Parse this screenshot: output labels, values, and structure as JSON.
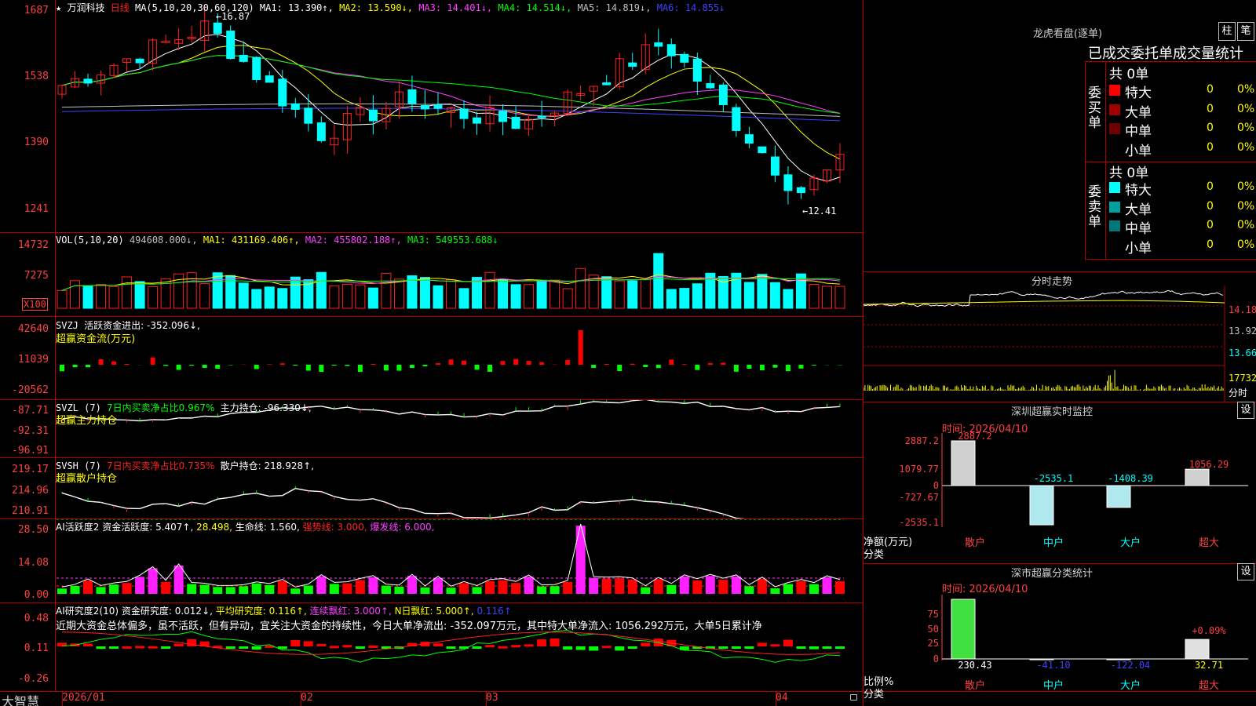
{
  "kline": {
    "star": "★",
    "stock_name": "万润科技",
    "period": "日线",
    "ma_header": "MA(5,10,20,30,60,120)",
    "ma_values": [
      {
        "label": "MA1: 13.390↑,",
        "color": "#ffffff"
      },
      {
        "label": "MA2: 13.590↓,",
        "color": "#ffff00"
      },
      {
        "label": "MA3: 14.401↓,",
        "color": "#ff40ff"
      },
      {
        "label": "MA4: 14.514↓,",
        "color": "#00ff00"
      },
      {
        "label": "MA5: 14.819↓,",
        "color": "#c0c0c0"
      },
      {
        "label": "MA6: 14.855↓",
        "color": "#4040ff"
      }
    ],
    "y_ticks": [
      "1687",
      "1538",
      "1390",
      "1241"
    ],
    "high_label": "16.87",
    "low_label": "12.41"
  },
  "vol": {
    "header": "VOL(5,10,20)",
    "values": [
      {
        "label": "494608.000↓,",
        "color": "#c0c0c0"
      },
      {
        "label": "MA1: 431169.406↑,",
        "color": "#ffff00"
      },
      {
        "label": "MA2: 455802.188↑,",
        "color": "#ff40ff"
      },
      {
        "label": "MA3: 549553.688↓",
        "color": "#00ff00"
      }
    ],
    "y_ticks": [
      "14732",
      "7275"
    ],
    "unit": "X100"
  },
  "svzj": {
    "header": "SVZJ",
    "label": "活跃资金进出: -352.096↓,",
    "subtitle": "超赢资金流(万元)",
    "y_ticks": [
      "42640",
      "11039",
      "-20562"
    ]
  },
  "svzl": {
    "header": "SVZL (7)",
    "label1": "7日内买卖净占比0.967%",
    "label2": "主力持仓: -96.330↓,",
    "subtitle": "超赢主力持仓",
    "y_ticks": [
      "-87.71",
      "-92.31",
      "-96.91"
    ]
  },
  "svsh": {
    "header": "SVSH (7)",
    "label1": "7日内买卖净占比0.735%",
    "label2": "散户持仓: 218.928↑,",
    "subtitle": "超赢散户持仓",
    "y_ticks": [
      "219.17",
      "214.96",
      "210.91"
    ]
  },
  "ai_active": {
    "header": "AI活跃度2",
    "values": [
      {
        "label": "资金活跃度: 5.407↑,",
        "color": "#ffffff"
      },
      {
        "label": "28.498,",
        "color": "#ffff00"
      },
      {
        "label": "生命线: 1.560,",
        "color": "#ffffff"
      },
      {
        "label": "强势线: 3.000,",
        "color": "#ff2020"
      },
      {
        "label": "爆发线: 6.000,",
        "color": "#ff40ff"
      }
    ],
    "y_ticks": [
      "28.50",
      "14.08",
      "0.00"
    ]
  },
  "ai_research": {
    "header": "AI研究度2(10)",
    "values": [
      {
        "label": "资金研究度: 0.012↓,",
        "color": "#ffffff"
      },
      {
        "label": "平均研究度: 0.116↑,",
        "color": "#ffff00"
      },
      {
        "label": "连续飘红: 3.000↑,",
        "color": "#ff40ff"
      },
      {
        "label": "N日飘红: 5.000↑,",
        "color": "#ffff00"
      },
      {
        "label": "0.116↑",
        "color": "#4040ff"
      }
    ],
    "comment": "近期大资金总体偏多，虽不活跃，但有异动，宜关注大资金的持续性，今日大单净流出: -352.097万元，其中特大单净流入: 1056.292万元，大单5日累计净",
    "y_ticks": [
      "0.48",
      "0.11",
      "-0.26"
    ]
  },
  "x_axis": {
    "labels": [
      "2026/01",
      "02",
      "03",
      "04"
    ],
    "app_name": "大智慧"
  },
  "dragon": {
    "title": "龙虎看盘(逐单)",
    "btn_column": "柱",
    "btn_pen": "笔",
    "subtitle": "已成交委托单成交量统计",
    "buy_side": "委买单",
    "sell_side": "委卖单",
    "buy_total": "共 0单",
    "sell_total": "共 0单",
    "buy_rows": [
      {
        "label": "特大",
        "value": "0",
        "pct": "0%",
        "color": "#ff0000"
      },
      {
        "label": "大单",
        "value": "0",
        "pct": "0%",
        "color": "#a00000"
      },
      {
        "label": "中单",
        "value": "0",
        "pct": "0%",
        "color": "#700000"
      },
      {
        "label": "小单",
        "value": "0",
        "pct": "0%",
        "color": "#000000"
      }
    ],
    "sell_rows": [
      {
        "label": "特大",
        "value": "0",
        "pct": "0%",
        "color": "#00ffff"
      },
      {
        "label": "大单",
        "value": "0",
        "pct": "0%",
        "color": "#00a0a0"
      },
      {
        "label": "中单",
        "value": "0",
        "pct": "0%",
        "color": "#007878"
      },
      {
        "label": "小单",
        "value": "0",
        "pct": "0%",
        "color": "#000000"
      }
    ]
  },
  "intraday": {
    "title": "分时走势",
    "y_ticks": [
      "14.18",
      "13.92",
      "13.66"
    ],
    "vol_tick": "17732",
    "unit": "分时"
  },
  "sz_monitor": {
    "title": "深圳超赢实时监控",
    "settings": "设",
    "time": "时间: 2026/04/10",
    "y_ticks": [
      "2887.2",
      "1079.77",
      "0",
      "-727.67",
      "-2535.1"
    ],
    "y_label": "净额(万元)",
    "x_title": "分类",
    "categories": [
      "散户",
      "中户",
      "大户",
      "超大"
    ],
    "values": [
      2887.2,
      -2535.1,
      -1408.39,
      1056.29
    ],
    "value_labels": [
      "2887.2",
      "-2535.1",
      "-1408.39",
      "1056.29"
    ]
  },
  "sz_stats": {
    "title": "深市超赢分类统计",
    "settings": "设",
    "time": "时间: 2026/04/10",
    "y_ticks": [
      "75",
      "50",
      "25",
      "0"
    ],
    "y_label": "比例%",
    "x_title": "分类",
    "categories": [
      "散户",
      "中户",
      "大户",
      "超大"
    ],
    "values": [
      230.43,
      -41.1,
      -122.04,
      32.71
    ],
    "value_labels": [
      "230.43",
      "-41.10",
      "-122.04",
      "32.71"
    ],
    "extra_label": "+0.09%"
  }
}
